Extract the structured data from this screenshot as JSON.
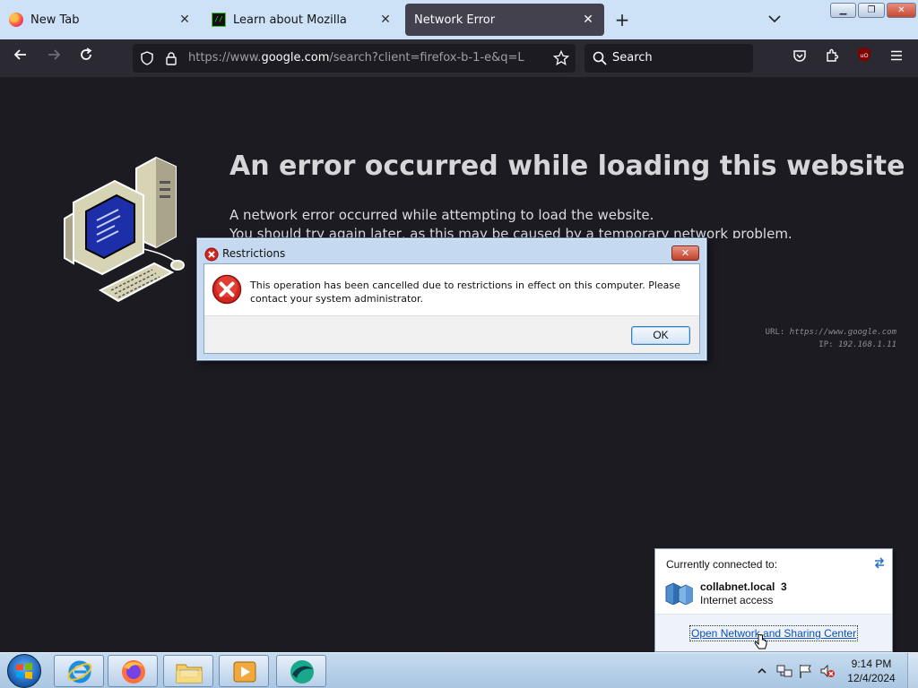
{
  "tabs": [
    {
      "title": "New Tab",
      "favicon": "firefox-icon",
      "active": false
    },
    {
      "title": "Learn about Mozilla",
      "favicon": "mozilla-icon",
      "active": false
    },
    {
      "title": "Network Error",
      "favicon": "",
      "active": true
    }
  ],
  "toolbar": {
    "url_prefix": "https://www.",
    "url_host": "google.com",
    "url_rest": "/search?client=firefox-b-1-e&q=L",
    "search_placeholder": "Search"
  },
  "error_page": {
    "title": "An error occurred while loading this website",
    "line1": "A network error occurred while attempting to load the website.",
    "line2": "You should try again later, as this may be caused by a temporary network problem.",
    "url_label": "URL:",
    "url_value": "https://www.google.com",
    "ip_label": "IP:",
    "ip_value": "192.168.1.11"
  },
  "dialog": {
    "title": "Restrictions",
    "message": "This operation has been cancelled due to restrictions in effect on this computer. Please contact your system administrator.",
    "ok_label": "OK"
  },
  "network_flyout": {
    "heading": "Currently connected to:",
    "network_name": "collabnet.local  3",
    "status": "Internet access",
    "link": "Open Network and Sharing Center"
  },
  "taskbar": {
    "apps": [
      "internet-explorer-icon",
      "firefox-icon",
      "file-explorer-icon",
      "media-player-icon",
      "app-icon"
    ],
    "time": "9:14 PM",
    "date": "12/4/2024"
  },
  "colors": {
    "page_bg": "#1c1b22",
    "toolbar_bg": "#2b2a33",
    "tabstrip_bg": "#cde2f6",
    "active_tab_bg": "#42414d",
    "dialog_error_red": "#d4261e",
    "link_blue": "#0a4cc1"
  }
}
